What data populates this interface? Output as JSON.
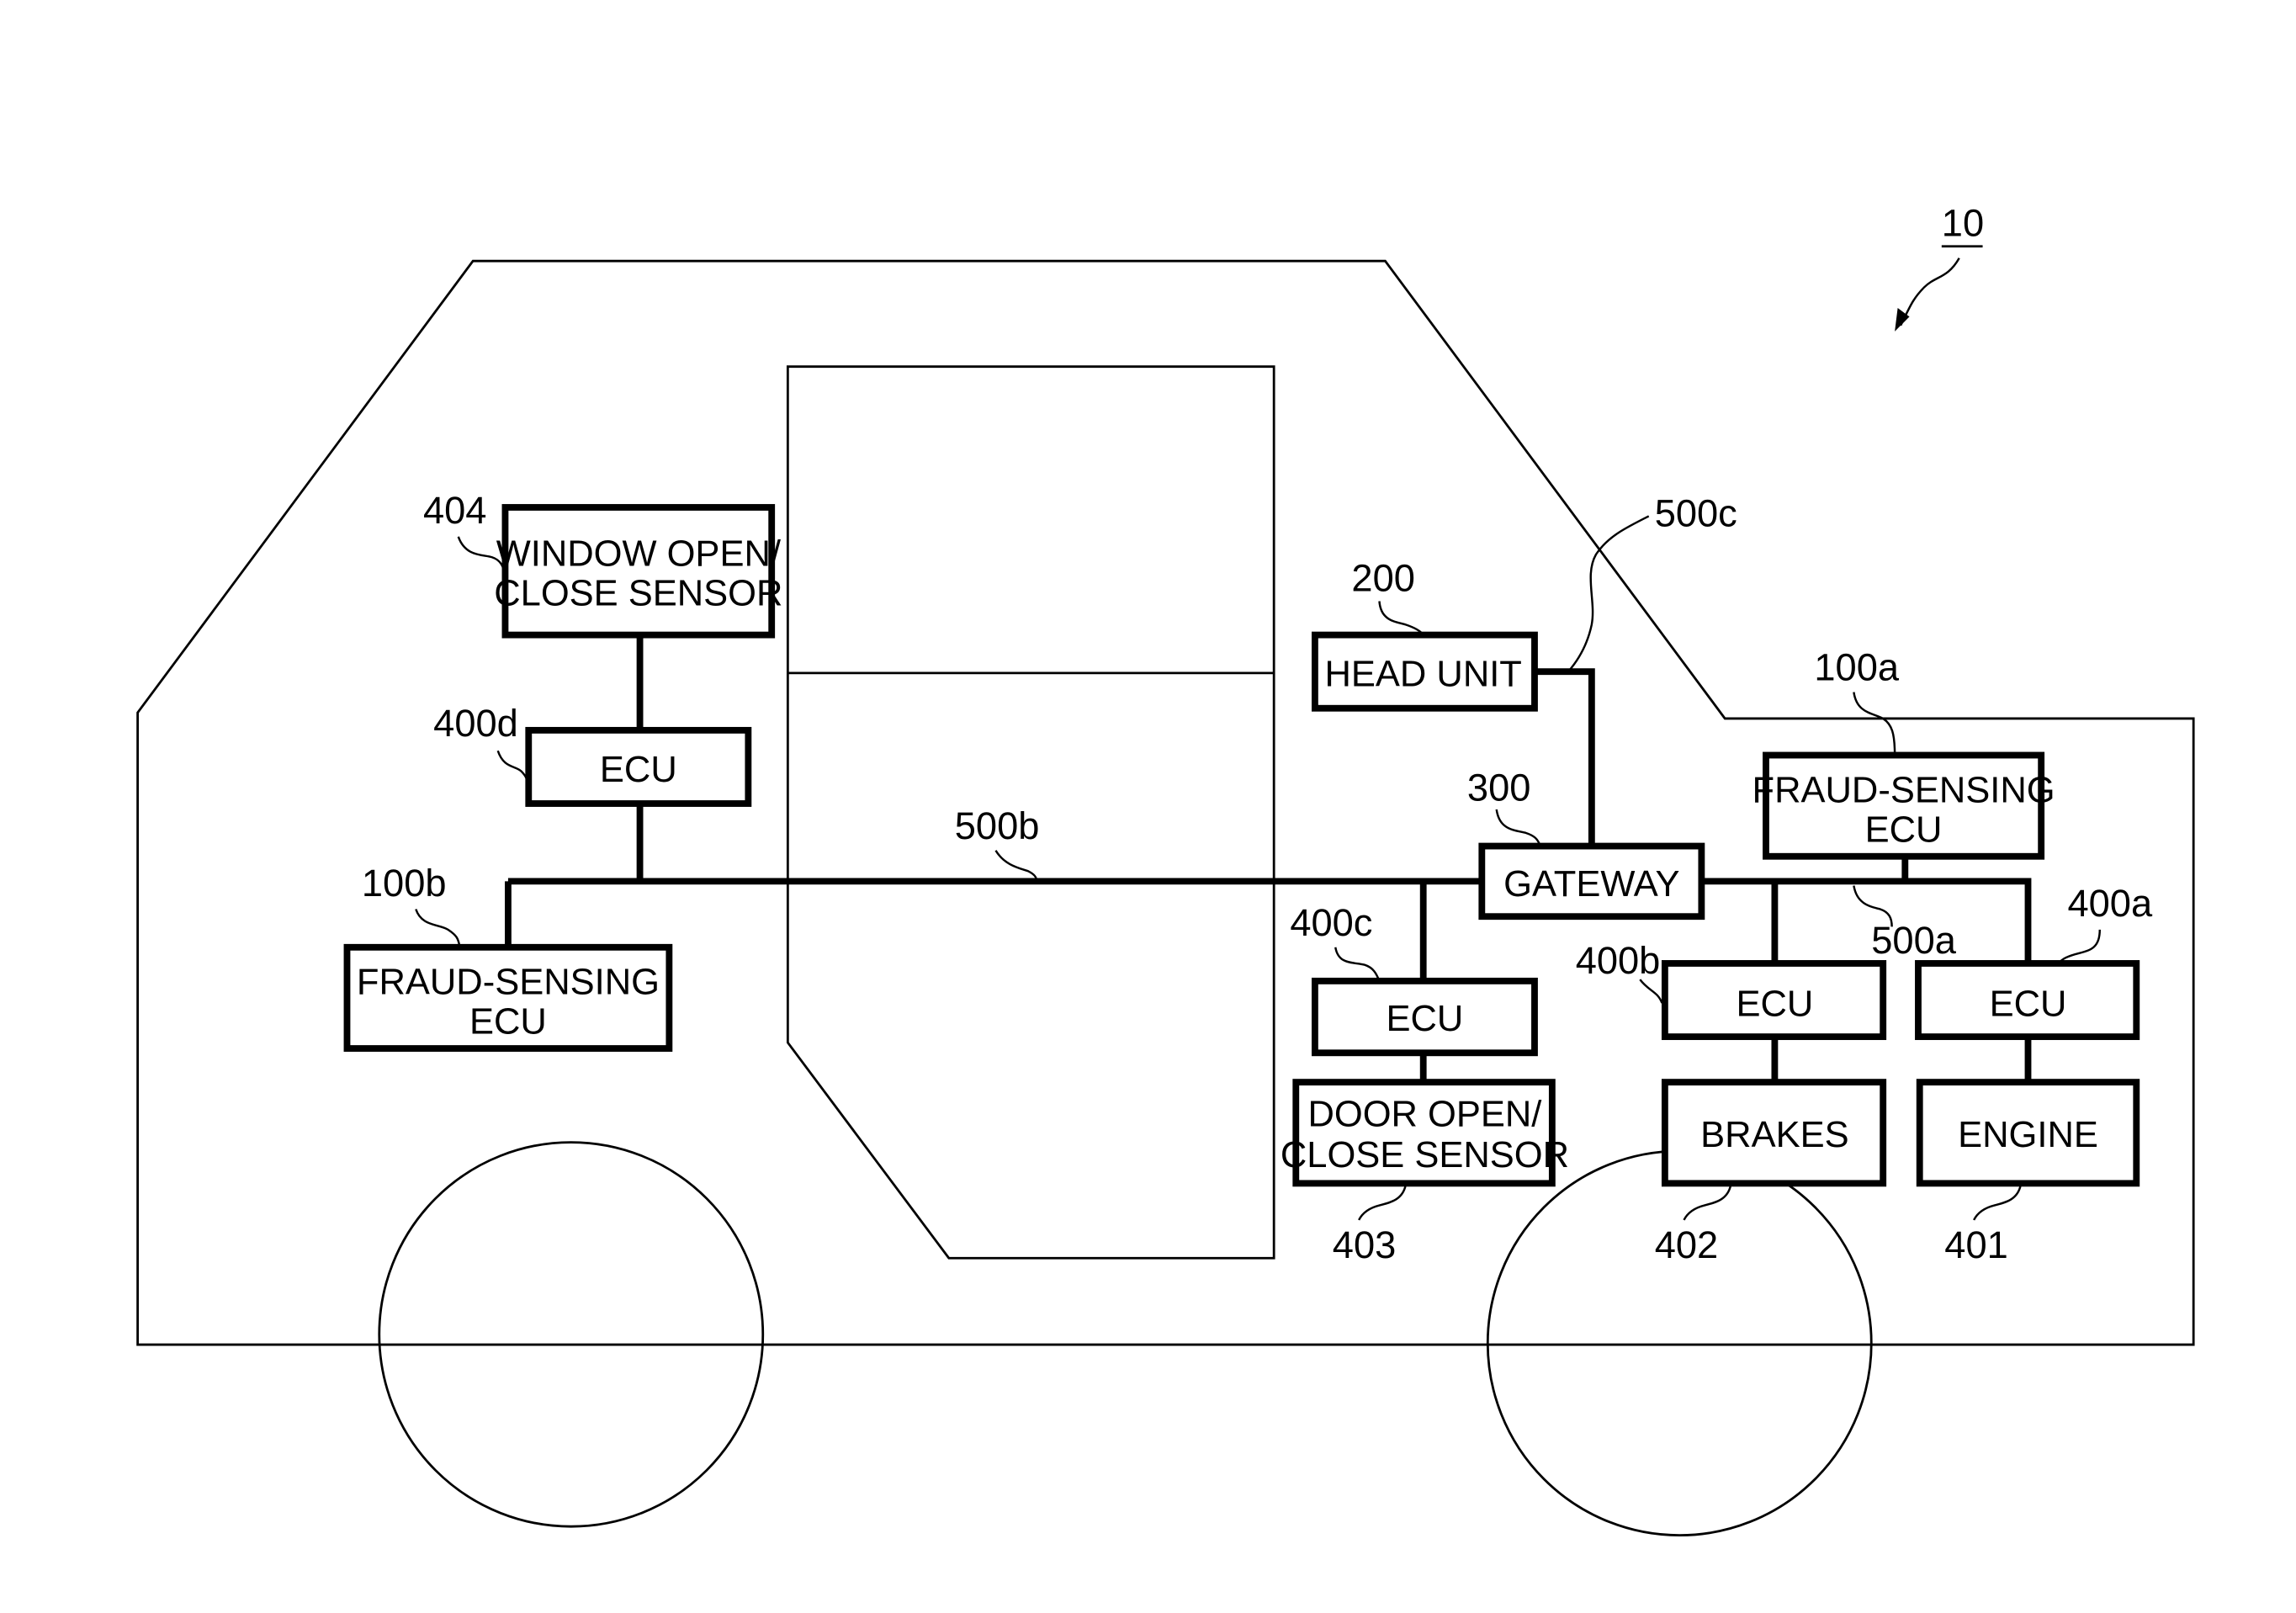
{
  "figure": {
    "ref": "10",
    "components": {
      "fraud_ecu_a": {
        "ref": "100a",
        "label_lines": [
          "FRAUD-SENSING",
          "ECU"
        ]
      },
      "fraud_ecu_b": {
        "ref": "100b",
        "label_lines": [
          "FRAUD-SENSING",
          "ECU"
        ]
      },
      "head_unit": {
        "ref": "200",
        "label": "HEAD UNIT"
      },
      "gateway": {
        "ref": "300",
        "label": "GATEWAY"
      },
      "ecu_a": {
        "ref": "400a",
        "label": "ECU"
      },
      "ecu_b": {
        "ref": "400b",
        "label": "ECU"
      },
      "ecu_c": {
        "ref": "400c",
        "label": "ECU"
      },
      "ecu_d": {
        "ref": "400d",
        "label": "ECU"
      },
      "engine": {
        "ref": "401",
        "label": "ENGINE"
      },
      "brakes": {
        "ref": "402",
        "label": "BRAKES"
      },
      "door_sensor": {
        "ref": "403",
        "label_lines": [
          "DOOR OPEN/",
          "CLOSE SENSOR"
        ]
      },
      "window_sensor": {
        "ref": "404",
        "label_lines": [
          "WINDOW OPEN/",
          "CLOSE SENSOR"
        ]
      }
    },
    "buses": {
      "bus_a": {
        "ref": "500a"
      },
      "bus_b": {
        "ref": "500b"
      },
      "bus_c": {
        "ref": "500c"
      }
    }
  }
}
